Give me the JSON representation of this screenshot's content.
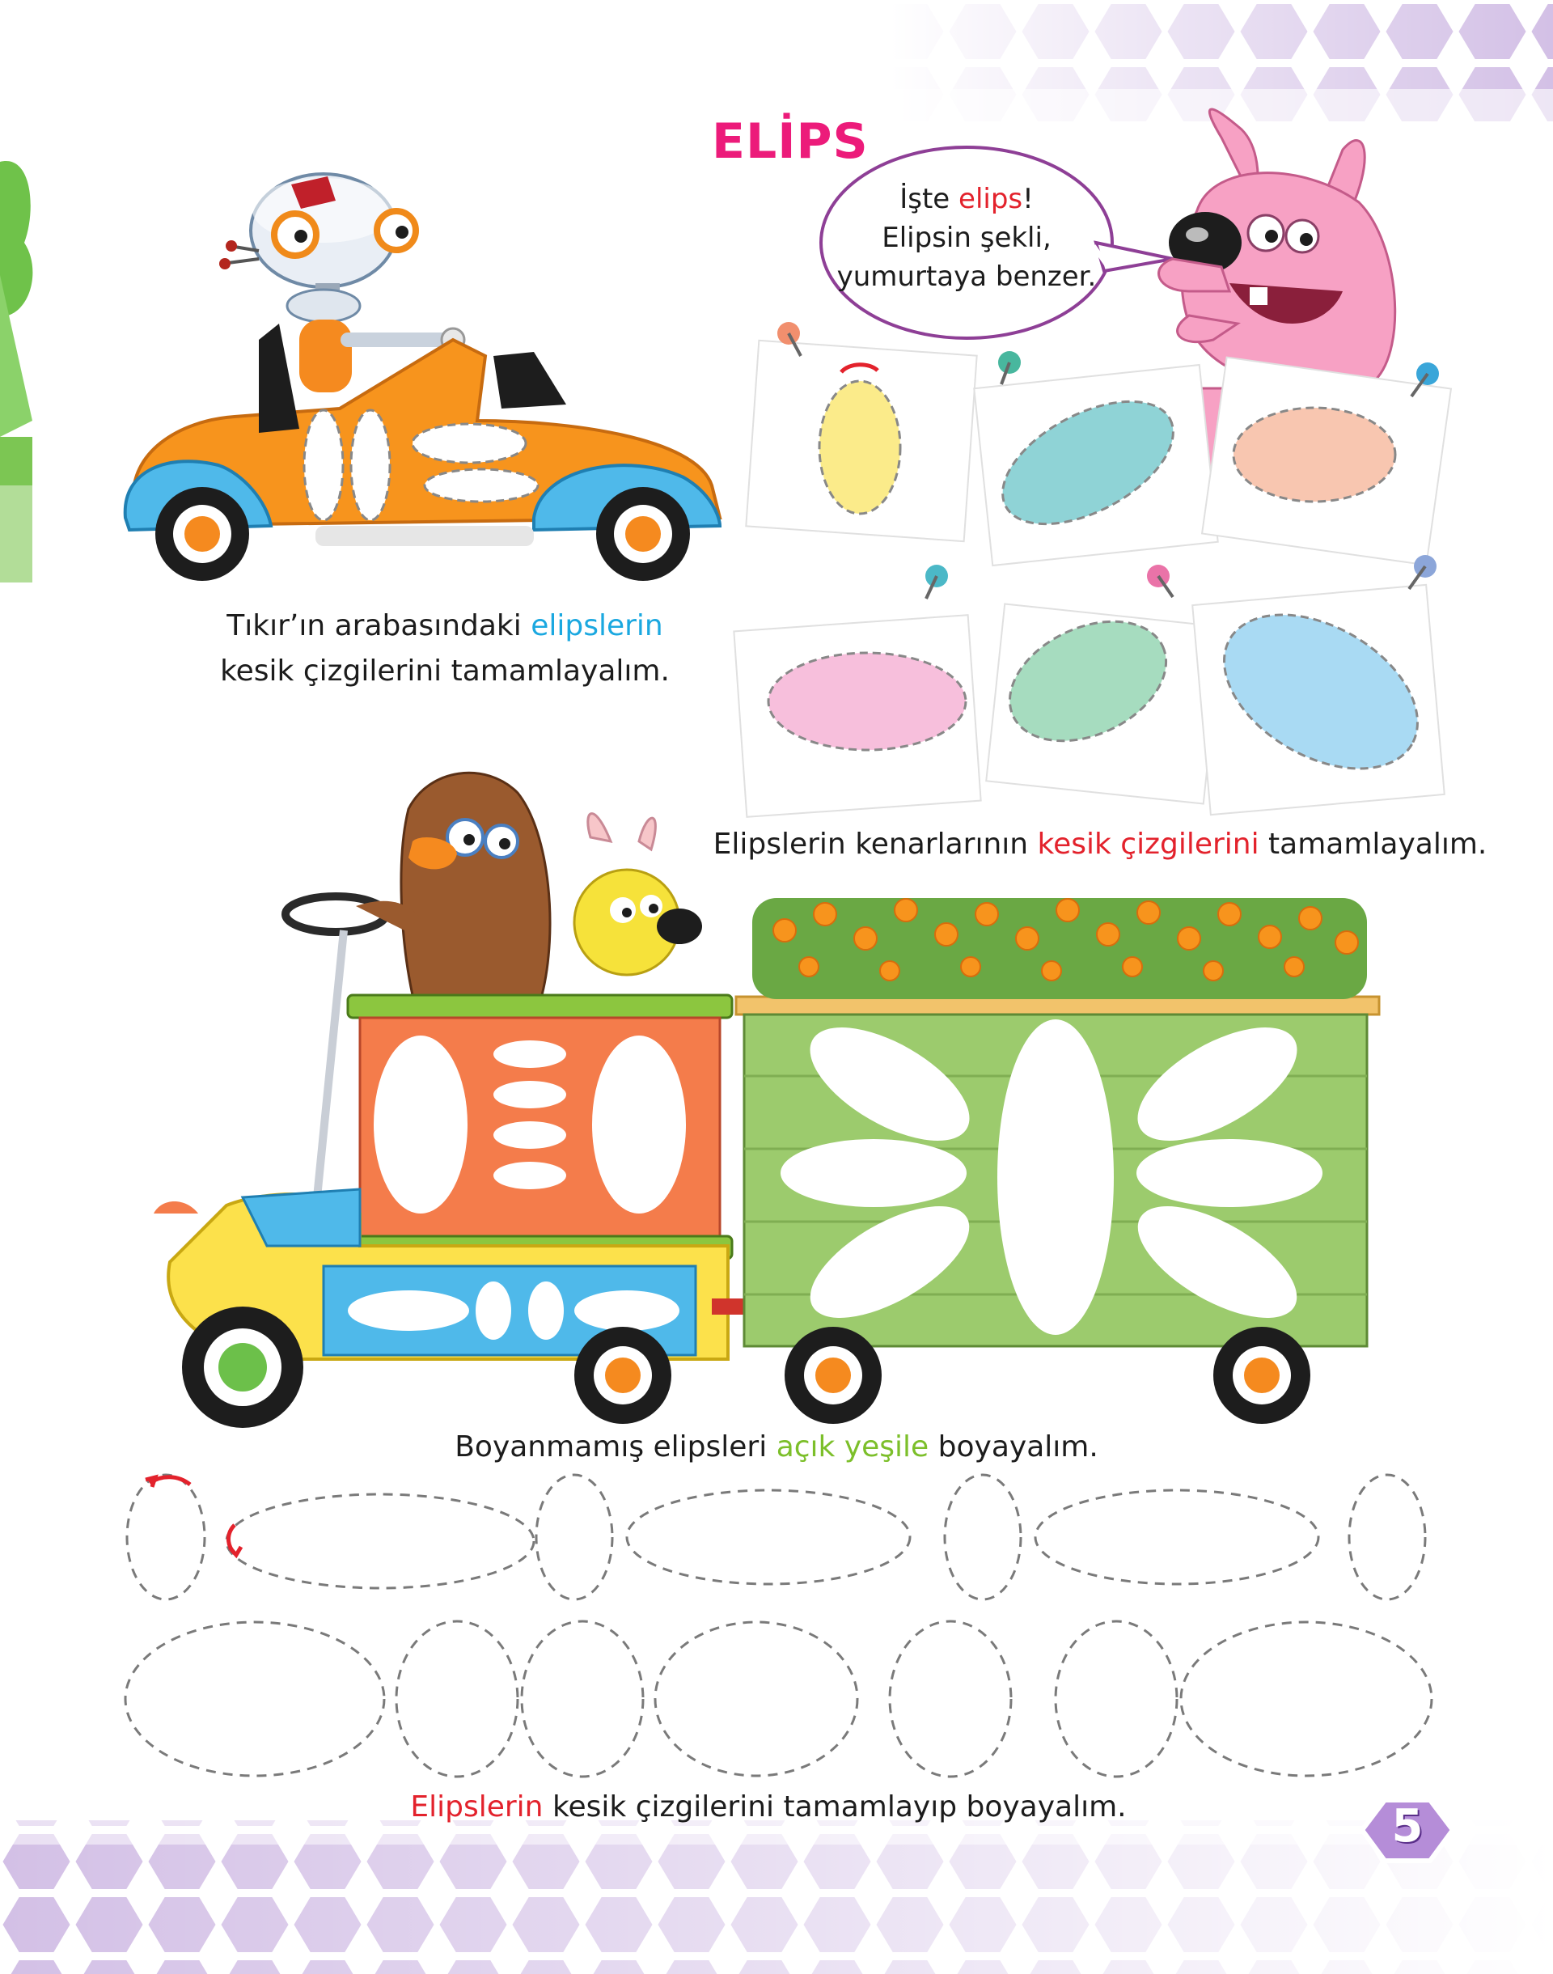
{
  "title": "ELİPS",
  "speech_bubble": {
    "line1_prefix": "İşte ",
    "line1_highlight": "elips",
    "line1_suffix": "!",
    "line2": "Elipsin şekli,",
    "line3": "yumurtaya benzer."
  },
  "instructions": {
    "car": {
      "prefix": "Tıkır’ın arabasındaki ",
      "highlight": "elipslerin",
      "line2": "kesik çizgilerini tamamlayalım."
    },
    "cards": {
      "prefix": "Elipslerin kenarlarının ",
      "highlight": "kesik çizgilerini",
      "suffix": " tamamlayalım."
    },
    "train": {
      "prefix": "Boyanmamış elipsleri ",
      "highlight": "açık yeşile",
      "suffix": " boyayalım."
    },
    "tracing": {
      "highlight": "Elipslerin",
      "suffix": " kesik çizgilerini tamamlayıp boyayalım."
    }
  },
  "card_colors": [
    "#fbeb8a",
    "#8fd3d6",
    "#f8c6b0",
    "#f7bfdc",
    "#a6dcbf",
    "#a9daf3"
  ],
  "colors": {
    "accent_pink": "#ec1b7a",
    "accent_red": "#e3222c",
    "accent_blue": "#1ba8e0",
    "accent_green": "#7cbf2a",
    "hexagon": "#c9b3e0"
  },
  "page_number": "5"
}
